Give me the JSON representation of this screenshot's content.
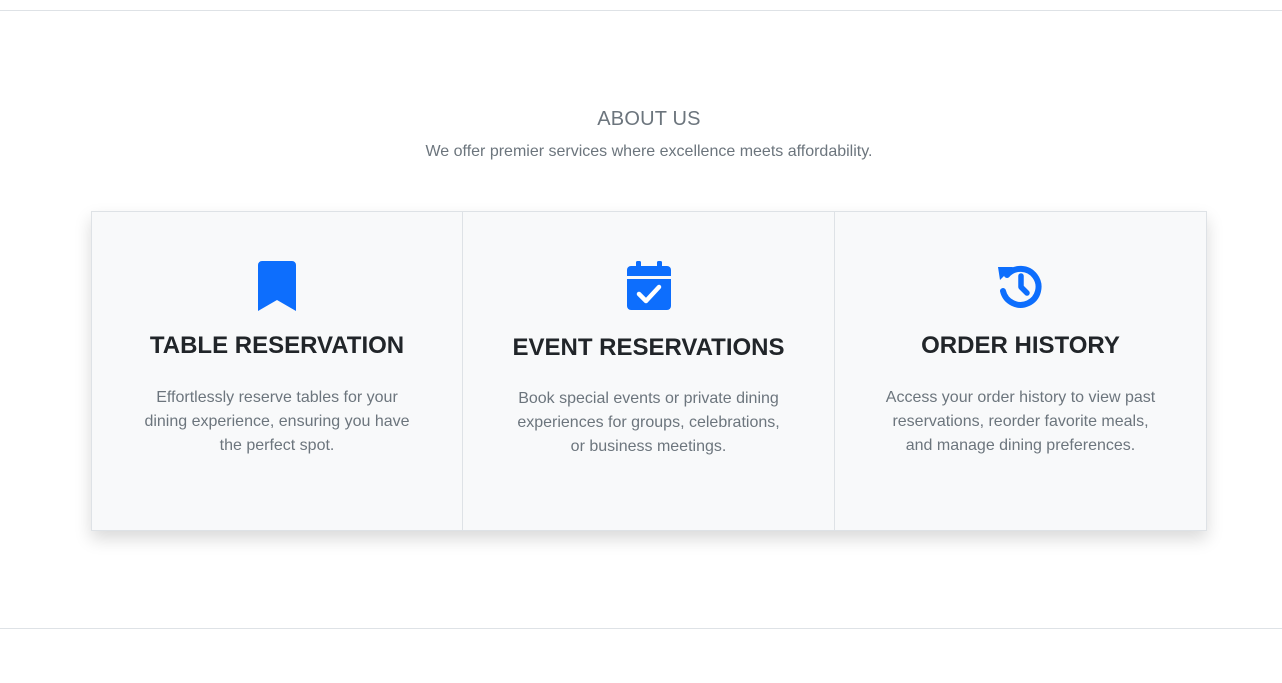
{
  "about": {
    "title": "ABOUT US",
    "subtitle": "We offer premier services where excellence meets affordability."
  },
  "accent_color": "#0d6efd",
  "cards": [
    {
      "icon": "bookmark-icon",
      "title": "TABLE RESERVATION",
      "text": "Effortlessly reserve tables for your dining experience, ensuring you have the perfect spot."
    },
    {
      "icon": "calendar-check-icon",
      "title": "EVENT RESERVATIONS",
      "text": "Book special events or private dining experiences for groups, celebrations, or business meetings."
    },
    {
      "icon": "history-icon",
      "title": "ORDER HISTORY",
      "text": "Access your order history to view past reservations, reorder favorite meals, and manage dining preferences."
    }
  ]
}
